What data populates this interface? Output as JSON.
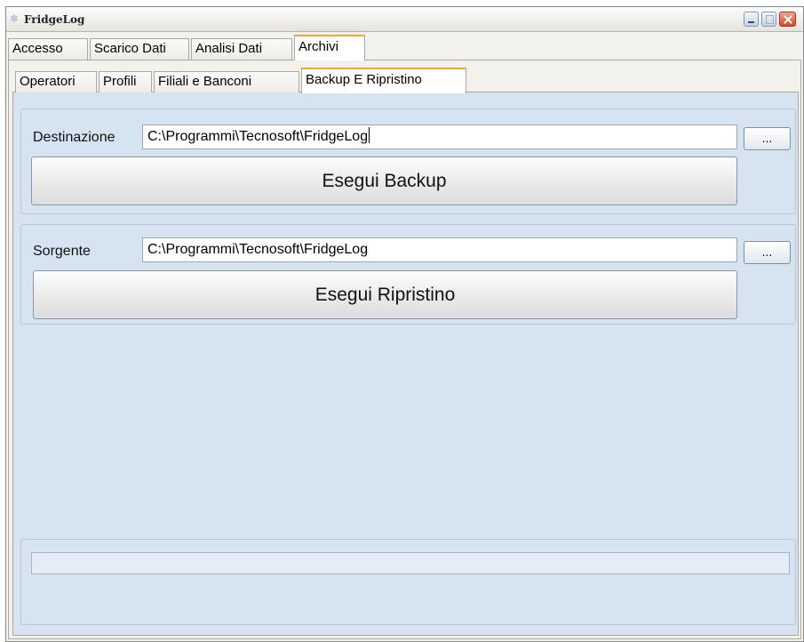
{
  "window": {
    "title": "FridgeLog"
  },
  "main_tabs": [
    {
      "label": "Accesso",
      "active": false
    },
    {
      "label": "Scarico Dati",
      "active": false
    },
    {
      "label": "Analisi Dati",
      "active": false
    },
    {
      "label": "Archivi",
      "active": true
    }
  ],
  "sub_tabs": [
    {
      "label": "Operatori",
      "active": false
    },
    {
      "label": "Profili",
      "active": false
    },
    {
      "label": "Filiali e Banconi",
      "active": false
    },
    {
      "label": "Backup E Ripristino",
      "active": true
    }
  ],
  "backup": {
    "label": "Destinazione",
    "path": "C:\\Programmi\\Tecnosoft\\FridgeLog",
    "browse_label": "...",
    "button_label": "Esegui Backup"
  },
  "restore": {
    "label": "Sorgente",
    "path": "C:\\Programmi\\Tecnosoft\\FridgeLog",
    "browse_label": "...",
    "button_label": "Esegui Ripristino"
  },
  "progress": {
    "value": 0
  },
  "colors": {
    "panel_bg": "#d6e4f2",
    "active_tab_accent": "#f0a830"
  },
  "icons": [
    "app-icon",
    "minimize-icon",
    "maximize-icon",
    "close-icon"
  ]
}
